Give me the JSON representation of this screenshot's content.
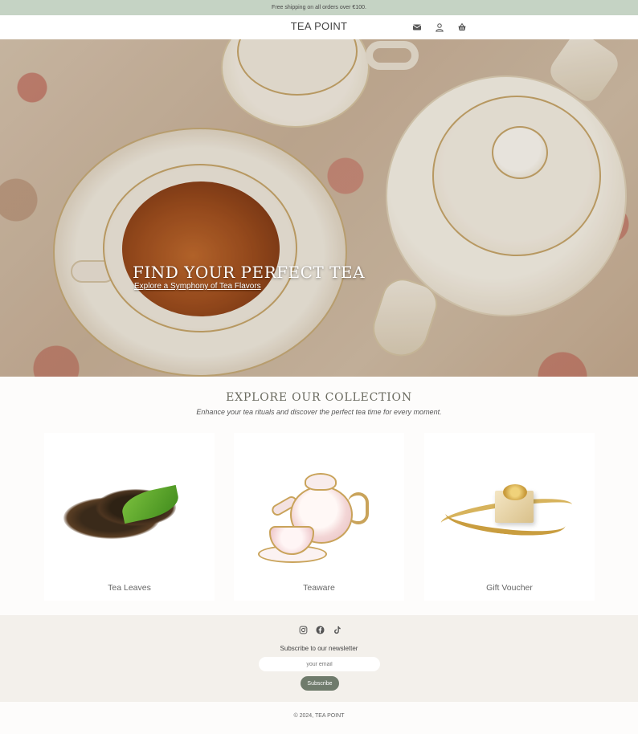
{
  "announcement": {
    "text": "Free shipping on all orders over €100."
  },
  "header": {
    "logo": "TEA POINT",
    "icons": [
      "mail-icon",
      "account-icon",
      "cart-icon"
    ]
  },
  "hero": {
    "title": "FIND YOUR PERFECT TEA",
    "subtitle_link": "Explore a Symphony of Tea Flavors"
  },
  "collection": {
    "title": "EXPLORE OUR COLLECTION",
    "subtitle": "Enhance your tea rituals and discover the perfect tea time for every moment.",
    "cards": [
      {
        "label": "Tea Leaves"
      },
      {
        "label": "Teaware"
      },
      {
        "label": "Gift Voucher"
      }
    ]
  },
  "footer": {
    "social_icons": [
      "instagram-icon",
      "facebook-icon",
      "tiktok-icon"
    ],
    "newsletter_title": "Subscribe to our newsletter",
    "email_placeholder": "your email",
    "subscribe_label": "Subscribe",
    "copyright_prefix": "© 2024,",
    "copyright_brand": "TEA POINT"
  },
  "colors": {
    "announcement_bg": "#c5d3c4",
    "footer_bg": "#f3f0eb",
    "subscribe_button": "#6f7b6c"
  }
}
